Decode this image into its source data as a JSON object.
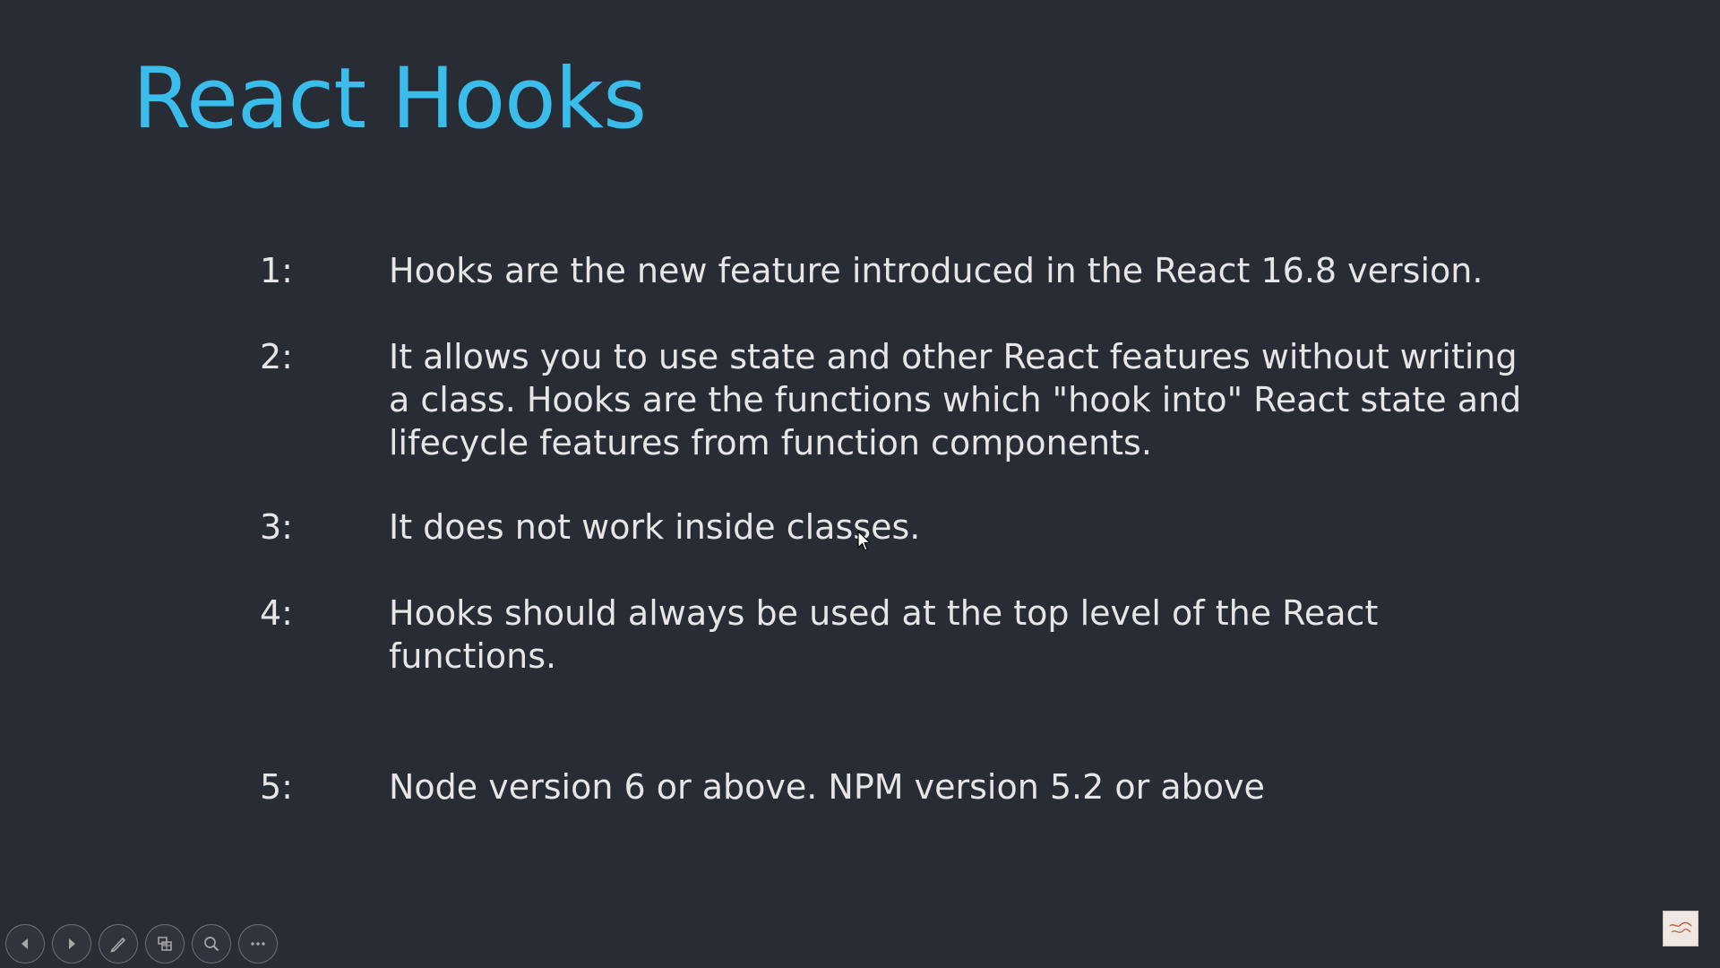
{
  "slide": {
    "title": "React Hooks",
    "items": [
      {
        "number": "1:",
        "text": "Hooks are the new feature introduced in the React 16.8 version."
      },
      {
        "number": "2:",
        "text": "It allows you to use state and other React features without writing\na class. Hooks are the functions which \"hook into\" React state and\nlifecycle features from function components."
      },
      {
        "number": "3:",
        "text": "It does not work inside classes."
      },
      {
        "number": "4:",
        "text": "Hooks should always be used at the top level of the React\nfunctions."
      },
      {
        "number": "5:",
        "text": "Node version 6 or above.   NPM version 5.2 or above"
      }
    ]
  },
  "presenter_toolbar": {
    "buttons": [
      {
        "icon": "previous-slide-icon"
      },
      {
        "icon": "next-slide-icon"
      },
      {
        "icon": "pen-icon"
      },
      {
        "icon": "slides-grid-icon"
      },
      {
        "icon": "zoom-icon"
      },
      {
        "icon": "more-options-icon"
      }
    ]
  },
  "corner_logo": {
    "icon": "channel-logo-icon"
  },
  "colors": {
    "background": "#282c35",
    "title": "#3bbdec",
    "body_text": "#e6e6e6"
  }
}
